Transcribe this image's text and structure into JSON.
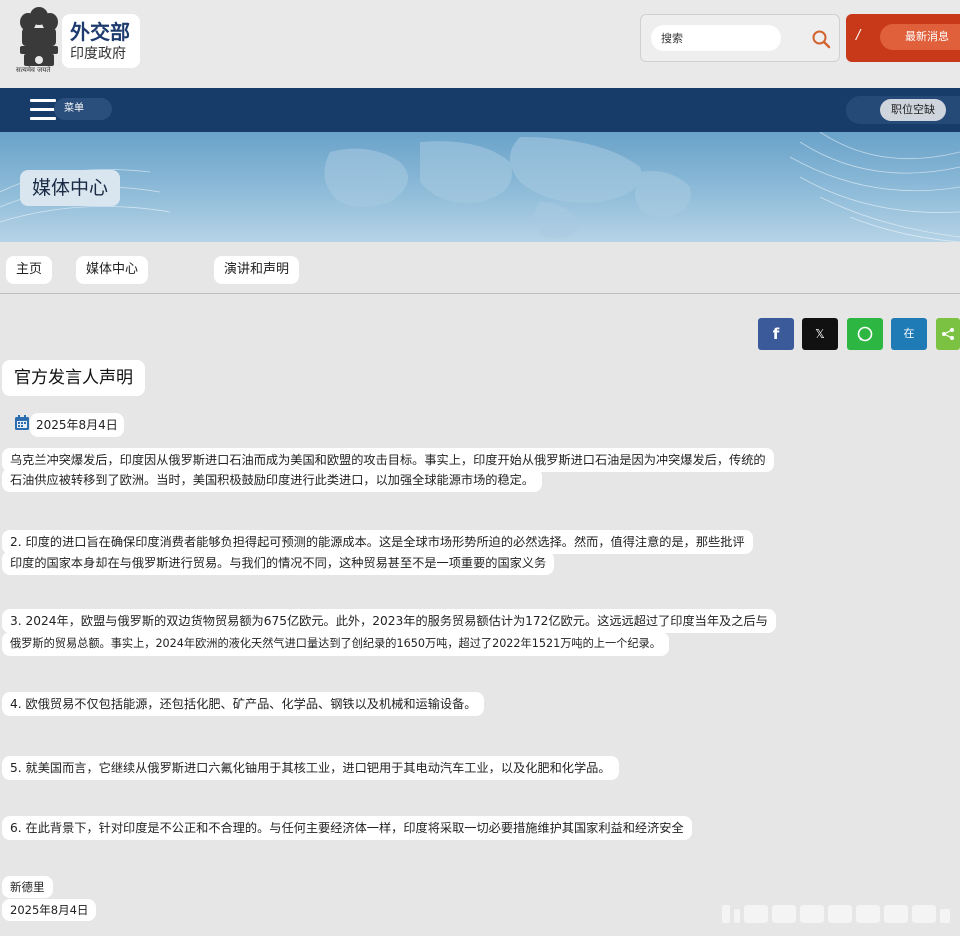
{
  "header": {
    "emblem_motto": "सत्यमेव जयते",
    "site_name": "外交部",
    "site_subtitle": "印度政府",
    "search_placeholder": "搜索",
    "latest_mark": "/",
    "latest_news": "最新消息"
  },
  "nav": {
    "menu_label": "菜单",
    "jobs_label": "职位空缺"
  },
  "banner": {
    "title": "媒体中心"
  },
  "breadcrumb": [
    "主页",
    "媒体中心",
    "演讲和声明"
  ],
  "share": {
    "facebook": "f",
    "x": "𝕏",
    "linkedin": "在"
  },
  "article": {
    "heading": "官方发言人声明",
    "date": "2025年8月4日",
    "paragraphs": [
      [
        "乌克兰冲突爆发后，印度因从俄罗斯进口石油而成为美国和欧盟的攻击目标。事实上，印度开始从俄罗斯进口石油是因为冲突爆发后，传统的",
        "石油供应被转移到了欧洲。当时，美国积极鼓励印度进行此类进口，以加强全球能源市场的稳定。"
      ],
      [
        "2. 印度的进口旨在确保印度消费者能够负担得起可预测的能源成本。这是全球市场形势所迫的必然选择。然而，值得注意的是，那些批评",
        "印度的国家本身却在与俄罗斯进行贸易。与我们的情况不同，这种贸易甚至不是一项重要的国家义务"
      ],
      [
        "3. 2024年，欧盟与俄罗斯的双边货物贸易额为675亿欧元。此外，2023年的服务贸易额估计为172亿欧元。这远远超过了印度当年及之后与",
        "俄罗斯的贸易总额。事实上，2024年欧洲的液化天然气进口量达到了创纪录的1650万吨，超过了2022年1521万吨的上一个纪录。"
      ],
      [
        "4. 欧俄贸易不仅包括能源，还包括化肥、矿产品、化学品、钢铁以及机械和运输设备。"
      ],
      [
        "5. 就美国而言，它继续从俄罗斯进口六氟化铀用于其核工业，进口钯用于其电动汽车工业，以及化肥和化学品。"
      ],
      [
        "6. 在此背景下，针对印度是不公正和不合理的。与任何主要经济体一样，印度将采取一切必要措施维护其国家利益和经济安全"
      ]
    ],
    "place": "新德里",
    "footer_date": "2025年8月4日"
  },
  "colors": {
    "navy": "#173c6a",
    "accent_red": "#c8391a",
    "facebook": "#3b5a9a",
    "x": "#111111",
    "whatsapp": "#2db742",
    "linkedin": "#1f7bb6",
    "share": "#7cc242"
  },
  "icons": [
    "search-icon",
    "calendar-icon",
    "hamburger-icon",
    "share-icon",
    "whatsapp-icon"
  ]
}
